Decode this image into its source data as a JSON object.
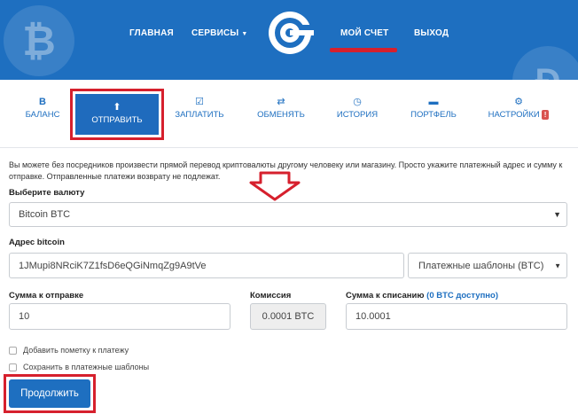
{
  "nav": {
    "home": "ГЛАВНАЯ",
    "services": "СЕРВИСЫ",
    "account": "МОЙ СЧЕТ",
    "logout": "ВЫХОД"
  },
  "tabs": {
    "balance": "БАЛАНС",
    "send": "ОТПРАВИТЬ",
    "pay": "ЗАПЛАТИТЬ",
    "exchange": "ОБМЕНЯТЬ",
    "history": "ИСТОРИЯ",
    "wallet": "ПОРТФЕЛЬ",
    "settings": "НАСТРОЙКИ",
    "settings_badge": "!"
  },
  "info_text": "Вы можете без посредников произвести прямой перевод криптовалюты другому человеку или магазину. Просто укажите платежный адрес и сумму к отправке. Отправленные платежи возврату не подлежат.",
  "currency": {
    "label": "Выберите валюту",
    "value": "Bitcoin BTC"
  },
  "address": {
    "label": "Адрес bitcoin",
    "value": "1JMupi8NRciK7Z1fsD6eQGiNmqZg9A9tVe",
    "templates_button": "Платежные шаблоны (BTC)"
  },
  "amount": {
    "label": "Сумма к отправке",
    "value": "10"
  },
  "fee": {
    "label": "Комиссия",
    "value": "0.0001 BTC"
  },
  "debit": {
    "label": "Сумма к списанию",
    "available": "(0 BTC доступно)",
    "value": "10.0001"
  },
  "options": {
    "add_note": "Добавить пометку к платежу",
    "save_template": "Сохранить в платежные шаблоны"
  },
  "submit": "Продолжить",
  "colors": {
    "brand_blue": "#1e6fc0",
    "highlight_red": "#d6202d"
  }
}
